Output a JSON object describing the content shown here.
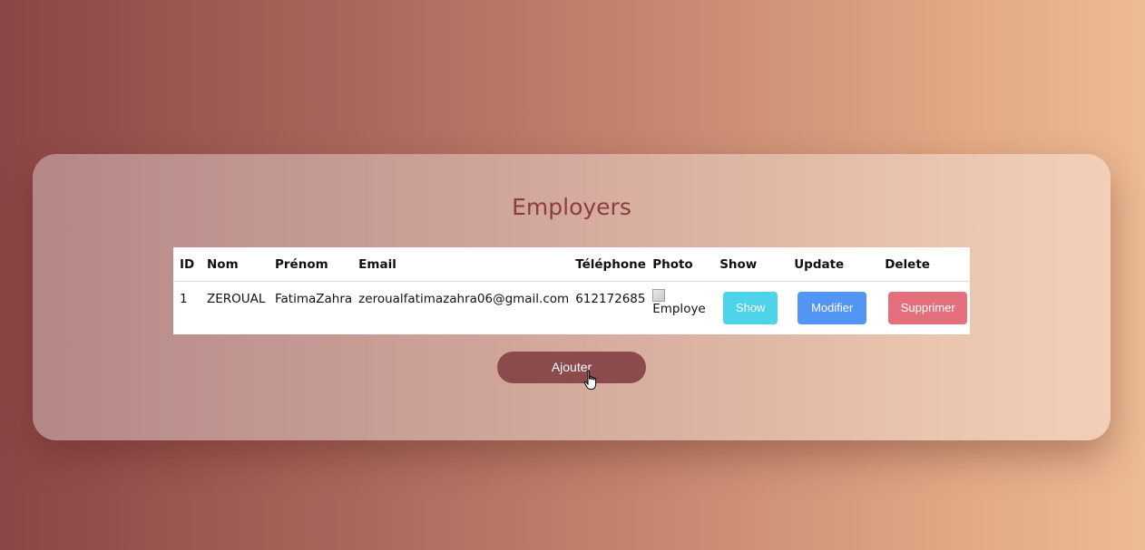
{
  "page": {
    "title": "Employers"
  },
  "table": {
    "headers": [
      "ID",
      "Nom",
      "Prénom",
      "Email",
      "Téléphone",
      "Photo",
      "Show",
      "Update",
      "Delete"
    ],
    "rows": [
      {
        "id": "1",
        "nom": "ZEROUAL",
        "prenom": "FatimaZahra",
        "email": "zeroualfatimazahra06@gmail.com",
        "telephone": "612172685",
        "photo_alt": "Employe",
        "show_label": "Show",
        "update_label": "Modifier",
        "delete_label": "Supprimer"
      }
    ]
  },
  "actions": {
    "add_label": "Ajouter"
  },
  "colors": {
    "title": "#8b3e42",
    "show_button": "#4dd3ea",
    "modify_button": "#5295f5",
    "delete_button": "#e3707c",
    "add_button": "#8b4a4b"
  }
}
